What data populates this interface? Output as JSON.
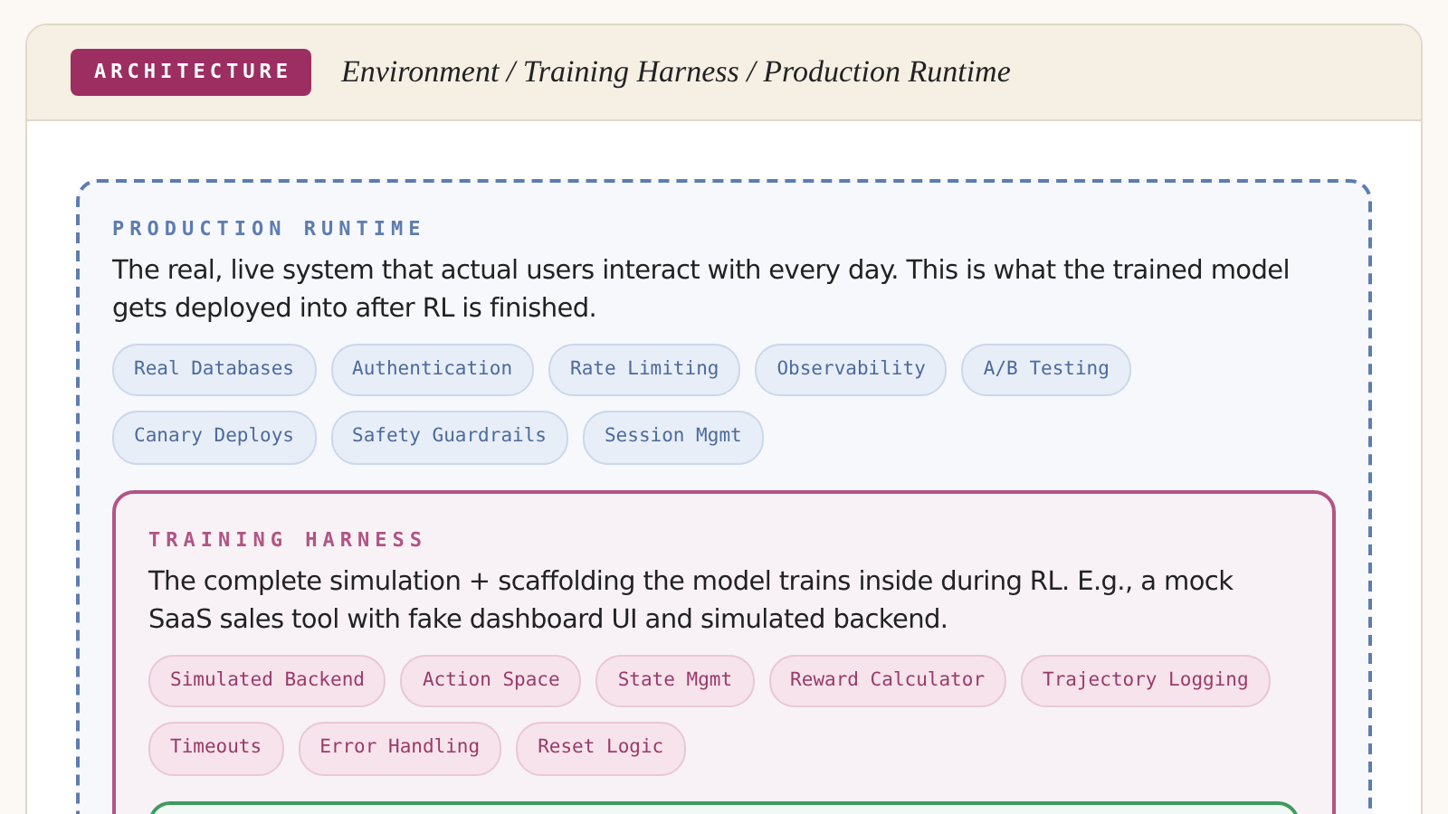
{
  "header": {
    "badge": "ARCHITECTURE",
    "title": "Environment / Training Harness / Production Runtime"
  },
  "layer": {
    "kind": "production",
    "label": "PRODUCTION RUNTIME",
    "description": "The real, live system that actual users interact with every day. This is what the trained model gets deployed into after RL is finished.",
    "tags": [
      "Real Databases",
      "Authentication",
      "Rate Limiting",
      "Observability",
      "A/B Testing",
      "Canary Deploys",
      "Safety Guardrails",
      "Session Mgmt"
    ],
    "children": [
      {
        "kind": "harness",
        "label": "TRAINING HARNESS",
        "description": "The complete simulation + scaffolding the model trains inside during RL. E.g., a mock SaaS sales tool with fake dashboard UI and simulated backend.",
        "tags": [
          "Simulated Backend",
          "Action Space",
          "State Mgmt",
          "Reward Calculator",
          "Trajectory Logging",
          "Timeouts",
          "Error Handling",
          "Reset Logic"
        ],
        "children": [
          {
            "kind": "environment"
          }
        ]
      }
    ]
  }
}
